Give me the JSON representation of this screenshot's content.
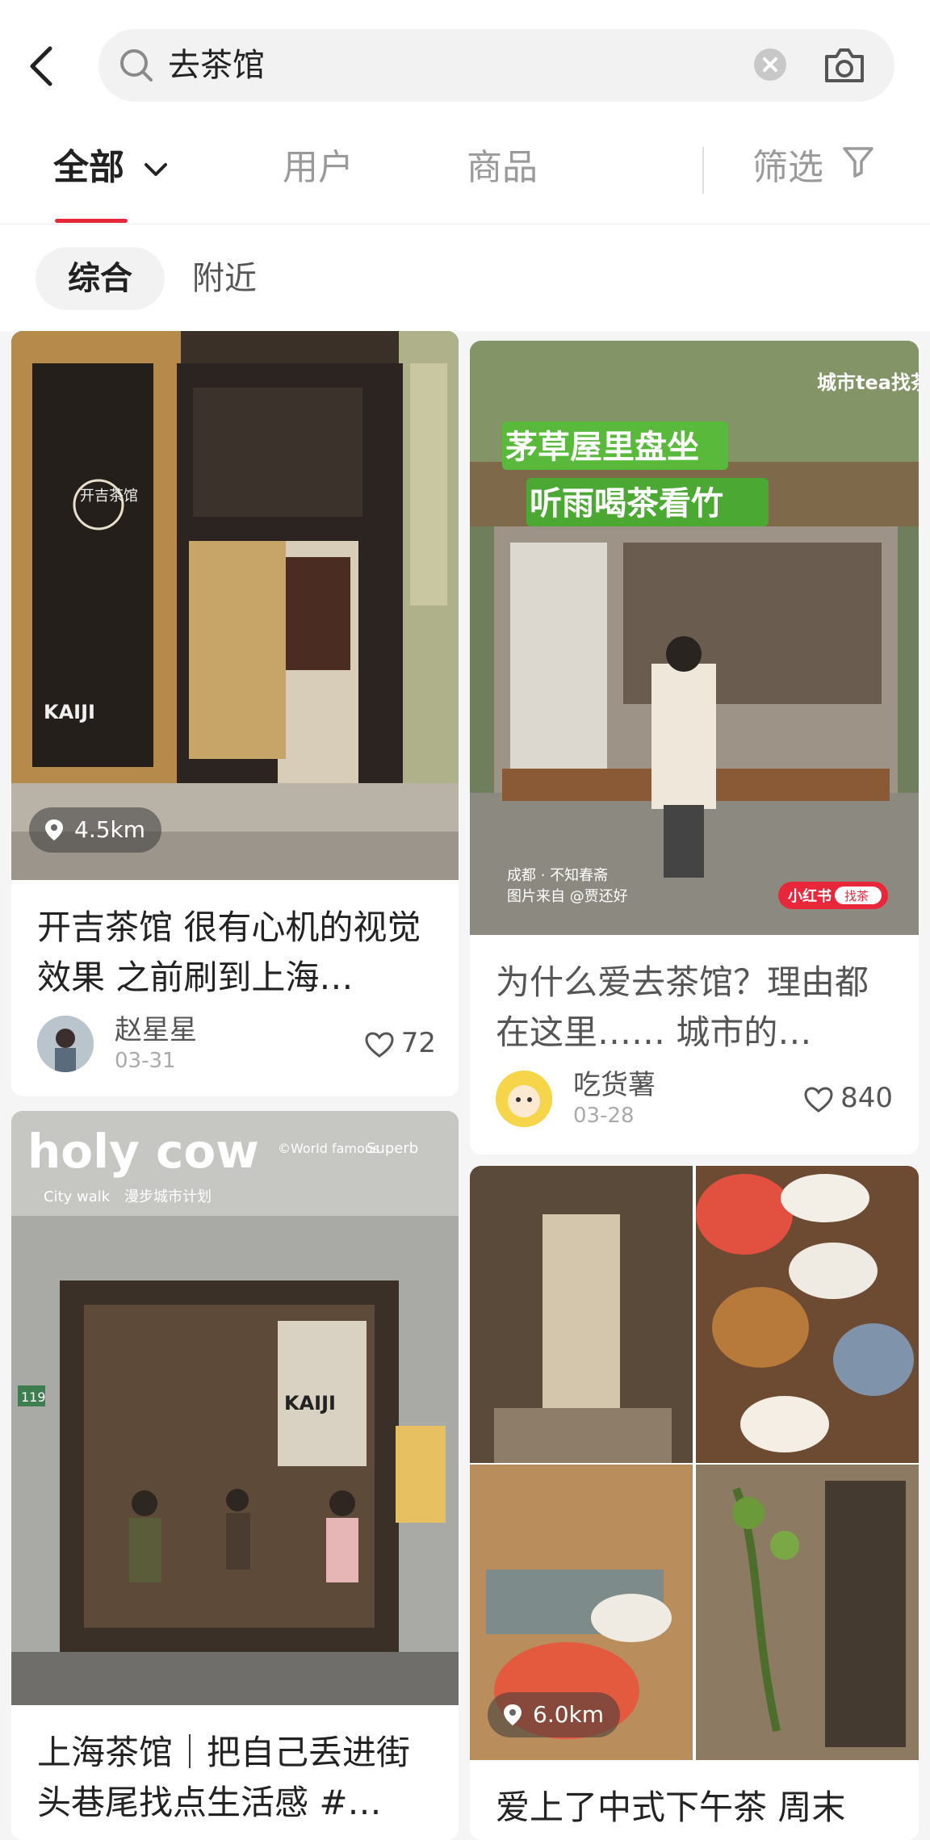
{
  "search": {
    "query": "去茶馆"
  },
  "tabs": [
    "全部",
    "用户",
    "商品"
  ],
  "filter_label": "筛选",
  "subtabs": [
    "综合",
    "附近"
  ],
  "cards": [
    {
      "distance": "4.5km",
      "title": "开吉茶馆 很有心机的视觉效果 之前刷到上海…",
      "user": "赵星星",
      "date": "03-31",
      "likes": "72",
      "image_text": {
        "sign": "开吉茶馆",
        "brand": "KAIJI"
      }
    },
    {
      "title": "为什么爱去茶馆？理由都在这里…… 城市的…",
      "user": "吃货薯",
      "date": "03-28",
      "likes": "840",
      "image_text": {
        "headline1": "茅草屋里盘坐",
        "headline2": "听雨喝茶看竹",
        "badge": "城市tea找茶去",
        "caption1": "成都 · 不知春斋",
        "caption2": "图片来自 @贾还好",
        "logo": "小红书",
        "logo_tag": "找茶"
      }
    },
    {
      "title": "上海茶馆｜把自己丢进街头巷尾找点生活感 #…",
      "image_text": {
        "headline": "holy cow",
        "sub": "City walk",
        "sub2": "漫步城市计划",
        "right1": "©World famous",
        "right2": "Superb",
        "door": "119",
        "shop": "KAIJI"
      }
    },
    {
      "distance": "6.0km",
      "title": "爱上了中式下午茶 周末"
    }
  ],
  "colors": {
    "accent": "#e8283a",
    "chip_bg": "#f2f2f2"
  }
}
